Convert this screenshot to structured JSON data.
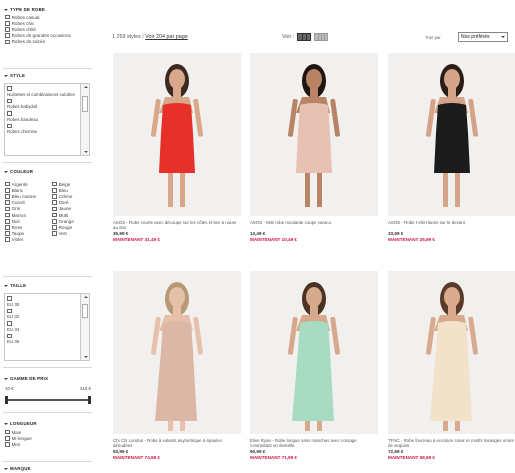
{
  "sidebar": {
    "dress_type": {
      "heading": "TYPE DE ROBE",
      "items": [
        "Robes casual",
        "Robes chic",
        "Robes d'été",
        "Robes de grandes occasions",
        "Robes de soirée"
      ]
    },
    "style": {
      "heading": "STYLE",
      "items": [
        "Nuisettes et combinaisons-culottes",
        "Robes babydoll",
        "Robes bandeau",
        "Robes chemise"
      ]
    },
    "color": {
      "heading": "COULEUR",
      "items": [
        "Argenté",
        "Beige",
        "Blanc",
        "Bleu",
        "Bleu marine",
        "Crème",
        "Cuivré",
        "Doré",
        "Gris",
        "Jaune",
        "Marron",
        "Multi",
        "Noir",
        "Orange",
        "Rose",
        "Rouge",
        "Taupe",
        "Vert",
        "Violet"
      ]
    },
    "size": {
      "heading": "TAILLE",
      "items": [
        "EU 30",
        "EU 32",
        "EU 34",
        "EU 36"
      ]
    },
    "price": {
      "heading": "GAMME DE PRIX",
      "min": "10 €",
      "max": "315 €",
      "selected_range": [
        10,
        315
      ]
    },
    "length": {
      "heading": "LONGUEUR",
      "items": [
        "Maxi",
        "Mi-longue",
        "Mini"
      ]
    },
    "brand": {
      "heading": "MARQUE"
    }
  },
  "toolbar": {
    "count": "1 259 styles",
    "separator": "|",
    "view_all": "Voir 204 par page",
    "view_label": "Voir :",
    "sort_label": "Trier par",
    "sort_value": "Nos préférés"
  },
  "products": [
    {
      "name": "ASOS - Robe courte avec découpe sur les côtés et lien à nouer au dos",
      "price": "36,99 €",
      "sale": "MAINTENANT 31,49 €",
      "dress_color": "#e8302a",
      "skin": "#d9a88a",
      "hair": "#3b2a22"
    },
    {
      "name": "ASOS - Mini robe moulante coupe caraco",
      "price": "13,49 €",
      "sale": "MAINTENANT 10,49 €",
      "dress_color": "#e7c1b1",
      "skin": "#b98366",
      "hair": "#1f1612"
    },
    {
      "name": "ASOS - Robe t-shirt lacée sur le devant",
      "price": "33,99 €",
      "sale": "MAINTENANT 26,99 €",
      "dress_color": "#1b1b1b",
      "skin": "#d5a387",
      "hair": "#2a1d17"
    },
    {
      "name": "Chi Chi London - Robe à volants asymétrique à épaules dénudées",
      "price": "93,99 €",
      "sale": "MAINTENANT 74,99 €",
      "dress_color": "#dcb7a5",
      "skin": "#e6c0a8",
      "hair": "#b79a73"
    },
    {
      "name": "Elise Ryan - Robe longue sans manches avec corsage contrastant en dentelle",
      "price": "90,99 €",
      "sale": "MAINTENANT 71,99 €",
      "dress_color": "#a7dcc3",
      "skin": "#d6a88c",
      "hair": "#4a3224"
    },
    {
      "name": "TFNC - Robe fourreau à encolure cœur et motifs losanges ornés de sequins",
      "price": "72,99 €",
      "sale": "MAINTENANT 58,99 €",
      "dress_color": "#f1e2c9",
      "skin": "#d9aa8e",
      "hair": "#5a3a28"
    }
  ],
  "colors": {
    "sale": "#d01345",
    "accent": "#333333"
  }
}
